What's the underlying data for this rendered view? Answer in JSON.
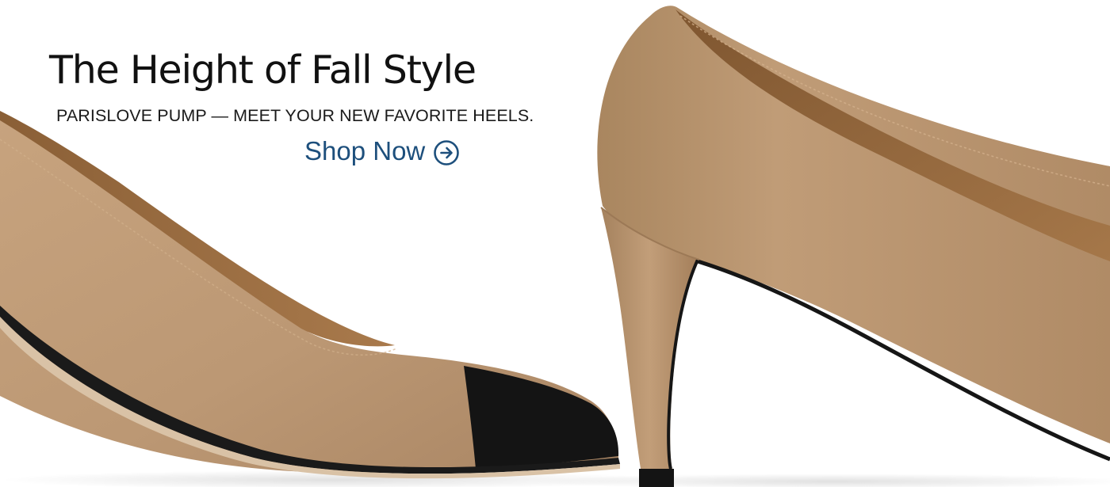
{
  "hero": {
    "headline": "The Height of Fall Style",
    "subheadline": "PARISLOVE PUMP — MEET YOUR NEW FAVORITE HEELS.",
    "cta_label": "Shop Now",
    "cta_icon": "arrow-circle-right-icon"
  },
  "colors": {
    "cta_text": "#1d4f7c",
    "headline_text": "#111111",
    "shoe_leather": "#bc9874",
    "shoe_toe_cap": "#141414",
    "background": "#ffffff"
  }
}
